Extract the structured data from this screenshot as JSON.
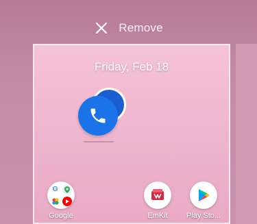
{
  "top_bar": {
    "remove_label": "Remove"
  },
  "preview": {
    "date": "Friday, Feb 18"
  },
  "dragged_app": {
    "icon": "phone-icon",
    "color": "#1a73e8"
  },
  "apps": [
    {
      "label": "Google",
      "icon": "google-folder-icon"
    },
    {
      "label": "EmKit",
      "icon": "emkit-icon"
    },
    {
      "label": "Play Sto...",
      "icon": "play-store-icon"
    }
  ],
  "colors": {
    "background": "#c38aa8",
    "wallpaper": "#f4c2d7",
    "accent_blue": "#1a73e8"
  }
}
